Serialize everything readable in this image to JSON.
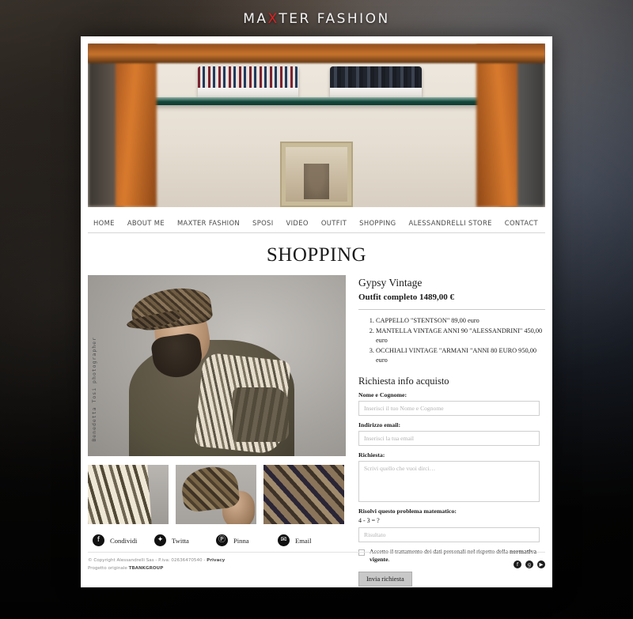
{
  "site": {
    "logo_prefix": "MA",
    "logo_accent": "X",
    "logo_suffix": "TER FASHION"
  },
  "nav": {
    "items": [
      {
        "label": "HOME",
        "name": "nav-home"
      },
      {
        "label": "ABOUT ME",
        "name": "nav-about-me"
      },
      {
        "label": "MAXTER FASHION",
        "name": "nav-maxter-fashion"
      },
      {
        "label": "SPOSI",
        "name": "nav-sposi"
      },
      {
        "label": "VIDEO",
        "name": "nav-video"
      },
      {
        "label": "OUTFIT",
        "name": "nav-outfit"
      },
      {
        "label": "SHOPPING",
        "name": "nav-shopping"
      },
      {
        "label": "ALESSANDRELLI STORE",
        "name": "nav-alessandrelli-store"
      },
      {
        "label": "CONTACT",
        "name": "nav-contact"
      }
    ]
  },
  "page": {
    "title": "SHOPPING"
  },
  "gallery": {
    "watermark": "Benedetta Tosi photographer",
    "main_alt": "man-in-flat-cap-and-shawl",
    "thumbs": [
      {
        "alt": "striped-shawl-detail"
      },
      {
        "alt": "flat-cap-side-view"
      },
      {
        "alt": "tweed-fabric-closeup"
      }
    ]
  },
  "share": {
    "items": [
      {
        "label": "Condividi",
        "icon": "facebook-icon",
        "glyph": "f"
      },
      {
        "label": "Twitta",
        "icon": "twitter-icon",
        "glyph": "✦"
      },
      {
        "label": "Pinna",
        "icon": "pinterest-icon",
        "glyph": "Ⓟ"
      },
      {
        "label": "Email",
        "icon": "email-icon",
        "glyph": "✉"
      }
    ]
  },
  "product": {
    "name": "Gypsy Vintage",
    "price_line": "Outfit completo 1489,00 €",
    "items": [
      "CAPPELLO \"STENTSON\" 89,00 euro",
      "MANTELLA VINTAGE ANNI 90 \"ALESSANDRINI\" 450,00 euro",
      "OCCHIALI VINTAGE \"ARMANI \"ANNI 80 EURO 950,00 euro"
    ]
  },
  "form": {
    "title": "Richiesta info acquisto",
    "name_label": "Nome e Cognome:",
    "name_placeholder": "Inserisci il tuo Nome e Cognome",
    "name_value": "",
    "email_label": "Indirizzo email:",
    "email_placeholder": "Inserisci la tua email",
    "email_value": "",
    "message_label": "Richiesta:",
    "message_placeholder": "Scrivi quello che vuoi dirci…",
    "message_value": "",
    "captcha_label": "Risolvi questo problema matematico:",
    "captcha_question": "4 - 3 = ?",
    "captcha_placeholder": "Risultato",
    "captcha_value": "",
    "consent_text": "Accetto il trattamento dei dati personali nel rispetto della ",
    "consent_link": "normativa vigente",
    "consent_end": ".",
    "submit_label": "Invia richiesta"
  },
  "footer": {
    "copyright": "© Copyright Alessandrelli Sas - P.iva: 02636470540 - ",
    "privacy": "Privacy",
    "credit_prefix": "Progetto originale ",
    "credit_brand": "TBANKGROUP",
    "social": [
      {
        "icon": "facebook-icon",
        "glyph": "f"
      },
      {
        "icon": "google-plus-icon",
        "glyph": "g"
      },
      {
        "icon": "youtube-icon",
        "glyph": "▶"
      }
    ]
  },
  "colors": {
    "accent_red": "#dd2222",
    "page_bg": "#ffffff",
    "button_bg": "#c8c8c8"
  }
}
